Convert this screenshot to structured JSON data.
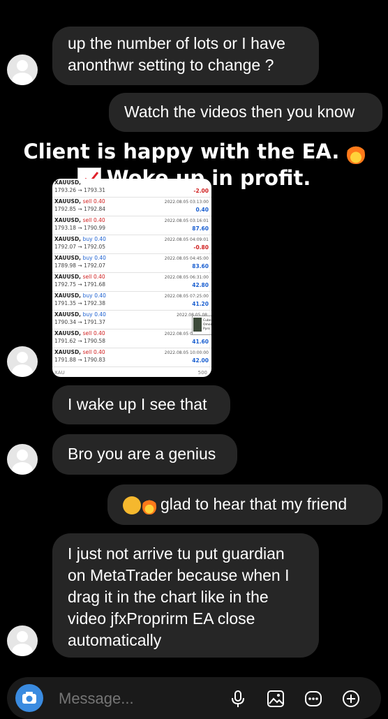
{
  "messages": [
    {
      "from": "other",
      "text": "up the number of lots or I have anonthwr setting to change ?"
    },
    {
      "from": "me",
      "text": "Watch the videos then you know"
    },
    {
      "from": "other",
      "text": "I wake up I see that"
    },
    {
      "from": "other",
      "text": "Bro you are a genius"
    },
    {
      "from": "me",
      "text": "glad to hear that my friend"
    },
    {
      "from": "other",
      "text": "I just not arrive tu put guardian on MetaTrader because when I drag it in the chart like in the video jfxProprirm EA close automatically"
    }
  ],
  "overlay": {
    "line1": "Client is happy with the EA.",
    "line2": "Woke up in profit."
  },
  "trades": [
    {
      "symbol": "XAUUSD,",
      "action": "",
      "lots": "",
      "prices": "1793.26 → 1793.31",
      "date": "",
      "profit": "-2.00",
      "profit_sign": "neg"
    },
    {
      "symbol": "XAUUSD,",
      "action": "sell",
      "lots": "0.40",
      "prices": "1792.85 → 1792.84",
      "date": "2022.08.05 03:13:00",
      "profit": "0.40",
      "profit_sign": "pos"
    },
    {
      "symbol": "XAUUSD,",
      "action": "sell",
      "lots": "0.40",
      "prices": "1793.18 → 1790.99",
      "date": "2022.08.05 03:16:01",
      "profit": "87.60",
      "profit_sign": "pos"
    },
    {
      "symbol": "XAUUSD,",
      "action": "buy",
      "lots": "0.40",
      "prices": "1792.07 → 1792.05",
      "date": "2022.08.05 04:09:01",
      "profit": "-0.80",
      "profit_sign": "neg"
    },
    {
      "symbol": "XAUUSD,",
      "action": "buy",
      "lots": "0.40",
      "prices": "1789.98 → 1792.07",
      "date": "2022.08.05 04:45:00",
      "profit": "83.60",
      "profit_sign": "pos"
    },
    {
      "symbol": "XAUUSD,",
      "action": "sell",
      "lots": "0.40",
      "prices": "1792.75 → 1791.68",
      "date": "2022.08.05 06:31:00",
      "profit": "42.80",
      "profit_sign": "pos"
    },
    {
      "symbol": "XAUUSD,",
      "action": "buy",
      "lots": "0.40",
      "prices": "1791.35 → 1792.38",
      "date": "2022.08.05 07:25:00",
      "profit": "41.20",
      "profit_sign": "pos"
    },
    {
      "symbol": "XAUUSD,",
      "action": "buy",
      "lots": "0.40",
      "prices": "1790.34 → 1791.37",
      "date": "2022.08.05 08:",
      "profit": "",
      "profit_sign": "pos"
    },
    {
      "symbol": "XAUUSD,",
      "action": "sell",
      "lots": "0.40",
      "prices": "1791.62 → 1790.58",
      "date": "2022.08.05 08:42:02",
      "profit": "41.60",
      "profit_sign": "pos"
    },
    {
      "symbol": "XAUUSD,",
      "action": "sell",
      "lots": "0.40",
      "prices": "1791.88 → 1790.83",
      "date": "2022.08.05 10:00:00",
      "profit": "42.00",
      "profit_sign": "pos"
    }
  ],
  "trade_footer": {
    "left": "XAU",
    "right": "500"
  },
  "popup_label": "Cube Omen Pyro",
  "input": {
    "placeholder": "Message..."
  },
  "icons": [
    "camera-icon",
    "mic-icon",
    "gallery-icon",
    "sticker-icon",
    "plus-icon"
  ],
  "colors": {
    "bubble": "#262626",
    "background": "#000000",
    "camera": "#3a8be0"
  }
}
